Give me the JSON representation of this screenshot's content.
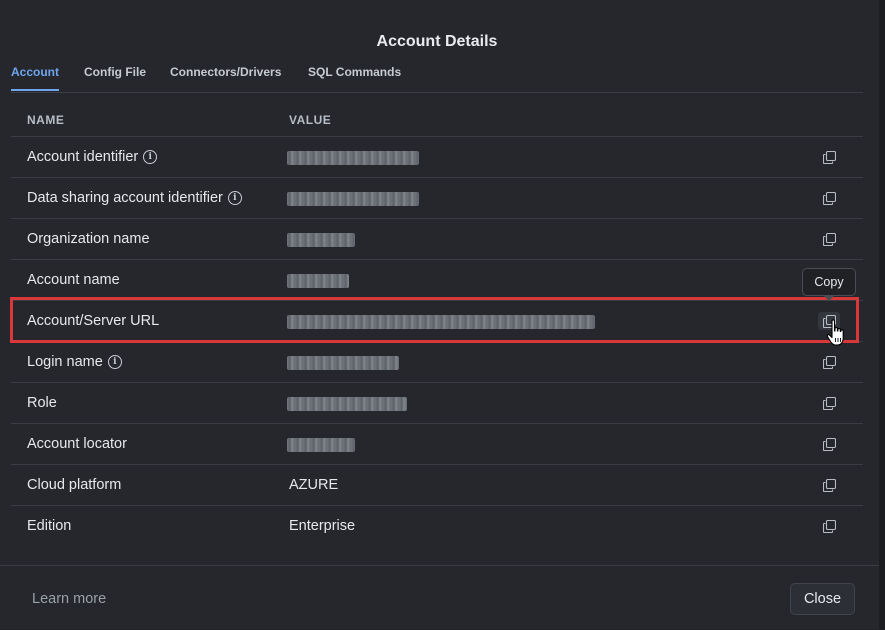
{
  "dialog": {
    "title": "Account Details",
    "tabs": [
      {
        "label": "Account",
        "active": true
      },
      {
        "label": "Config File",
        "active": false
      },
      {
        "label": "Connectors/Drivers",
        "active": false
      },
      {
        "label": "SQL Commands",
        "active": false
      }
    ],
    "table": {
      "headers": {
        "name": "NAME",
        "value": "VALUE"
      },
      "rows": [
        {
          "name": "Account identifier",
          "info": true,
          "value": "",
          "redacted": true
        },
        {
          "name": "Data sharing account identifier",
          "info": true,
          "value": "",
          "redacted": true
        },
        {
          "name": "Organization name",
          "info": false,
          "value": "",
          "redacted": true
        },
        {
          "name": "Account name",
          "info": false,
          "value": "",
          "redacted": true
        },
        {
          "name": "Account/Server URL",
          "info": false,
          "value": "",
          "redacted": true,
          "highlighted": true
        },
        {
          "name": "Login name",
          "info": true,
          "value": "",
          "redacted": true
        },
        {
          "name": "Role",
          "info": false,
          "value": "",
          "redacted": true
        },
        {
          "name": "Account locator",
          "info": false,
          "value": "",
          "redacted": true
        },
        {
          "name": "Cloud platform",
          "info": false,
          "value": "AZURE",
          "redacted": false
        },
        {
          "name": "Edition",
          "info": false,
          "value": "Enterprise",
          "redacted": false
        }
      ]
    },
    "copy_icon": "copy-icon",
    "info_icon": "info-icon",
    "info_glyph": "i",
    "tooltip": "Copy",
    "footer": {
      "learn_more": "Learn more",
      "close": "Close"
    },
    "colors": {
      "background": "#25272c",
      "accent": "#6ea5ee",
      "highlight": "#d9383a"
    }
  }
}
